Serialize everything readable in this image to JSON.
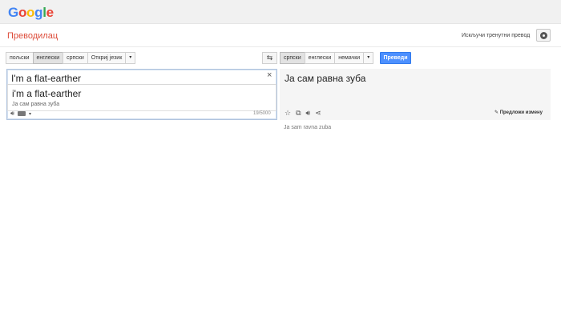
{
  "header": {
    "logo": {
      "letters": [
        {
          "ch": "G",
          "color": "#4285f4"
        },
        {
          "ch": "o",
          "color": "#ea4335"
        },
        {
          "ch": "o",
          "color": "#fbbc05"
        },
        {
          "ch": "g",
          "color": "#4285f4"
        },
        {
          "ch": "l",
          "color": "#34a853"
        },
        {
          "ch": "e",
          "color": "#ea4335"
        }
      ]
    },
    "app_title": "Преводилац",
    "instant_off": "Искључи тренутни превод",
    "settings_icon": "gear-icon"
  },
  "source_langs": [
    "пољски",
    "енглески",
    "српски",
    "Откриј језик"
  ],
  "source_active_index": 1,
  "target_langs": [
    "српски",
    "енглески",
    "немачки"
  ],
  "target_active_index": 0,
  "dropdown_glyph": "▾",
  "swap_glyph": "⇆",
  "translate_button": "Преведи",
  "source": {
    "text": "I'm a flat-earther",
    "clear_glyph": "×",
    "suggestion_main": "i'm a flat-earther",
    "suggestion_sub": "Ја сам равна зуба",
    "char_count": "19/5000",
    "speaker_icon": "speaker-icon",
    "keyboard_icon": "keyboard-icon"
  },
  "target": {
    "text": "Ја сам равна зуба",
    "suggest_edit": "Предложи измену",
    "transliteration": "Ja sam ravna zuba",
    "icons": [
      "star-icon",
      "copy-icon",
      "speaker-icon",
      "share-icon"
    ]
  }
}
